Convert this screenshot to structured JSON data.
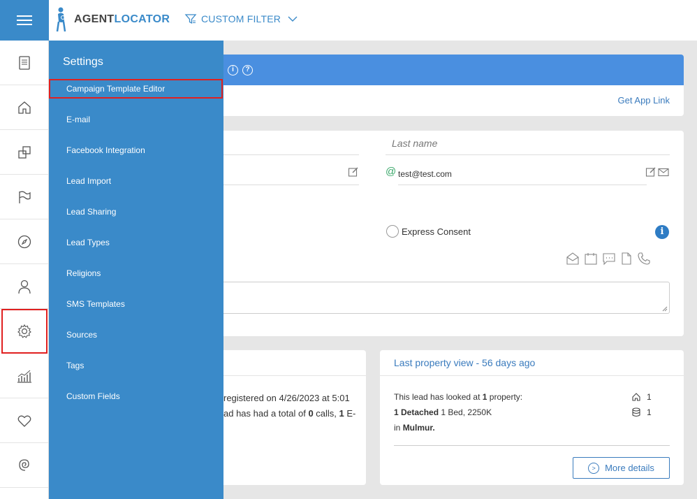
{
  "header": {
    "logo_part1": "AGENT",
    "logo_part2": "LOCATOR",
    "filter_label": "CUSTOM FILTER"
  },
  "settings_menu": {
    "title": "Settings",
    "items": [
      {
        "label": "Campaign Template Editor",
        "selected": true
      },
      {
        "label": "E-mail"
      },
      {
        "label": "Facebook Integration"
      },
      {
        "label": "Lead Import"
      },
      {
        "label": "Lead Sharing"
      },
      {
        "label": "Lead Types"
      },
      {
        "label": "Religions"
      },
      {
        "label": "SMS Templates"
      },
      {
        "label": "Sources"
      },
      {
        "label": "Tags"
      },
      {
        "label": "Custom Fields"
      }
    ]
  },
  "sidebar": {
    "icons": [
      "document-icon",
      "home-icon",
      "layers-icon",
      "flag-icon",
      "compass-icon",
      "user-icon",
      "gear-icon",
      "chart-icon",
      "heart-icon",
      "spiral-icon"
    ],
    "highlighted": "gear-icon"
  },
  "lead": {
    "get_app_link": "Get App Link",
    "last_name_placeholder": "Last name",
    "email": "test@test.com",
    "express_consent": "Express Consent",
    "registered_text_1": "registered on 4/26/2023 at 5:01",
    "registered_text_2a": "ad has had a total of ",
    "calls_count": "0",
    "registered_text_2b": " calls, ",
    "email_count": "1",
    "registered_text_2c": " E-"
  },
  "property_view": {
    "title": "Last property view - 56 days ago",
    "line1a": "This lead has looked at ",
    "line1_count": "1",
    "line1b": " property:",
    "line2_bold": "1 Detached",
    "line2_rest": " 1 Bed, 2250K",
    "line3a": "in ",
    "line3_bold": "Mulmur.",
    "home_count": "1",
    "db_count": "1",
    "more_details": "More details"
  },
  "colors": {
    "primary": "#3a8ac9",
    "highlight": "#e02020",
    "link": "#3a7bbd"
  }
}
